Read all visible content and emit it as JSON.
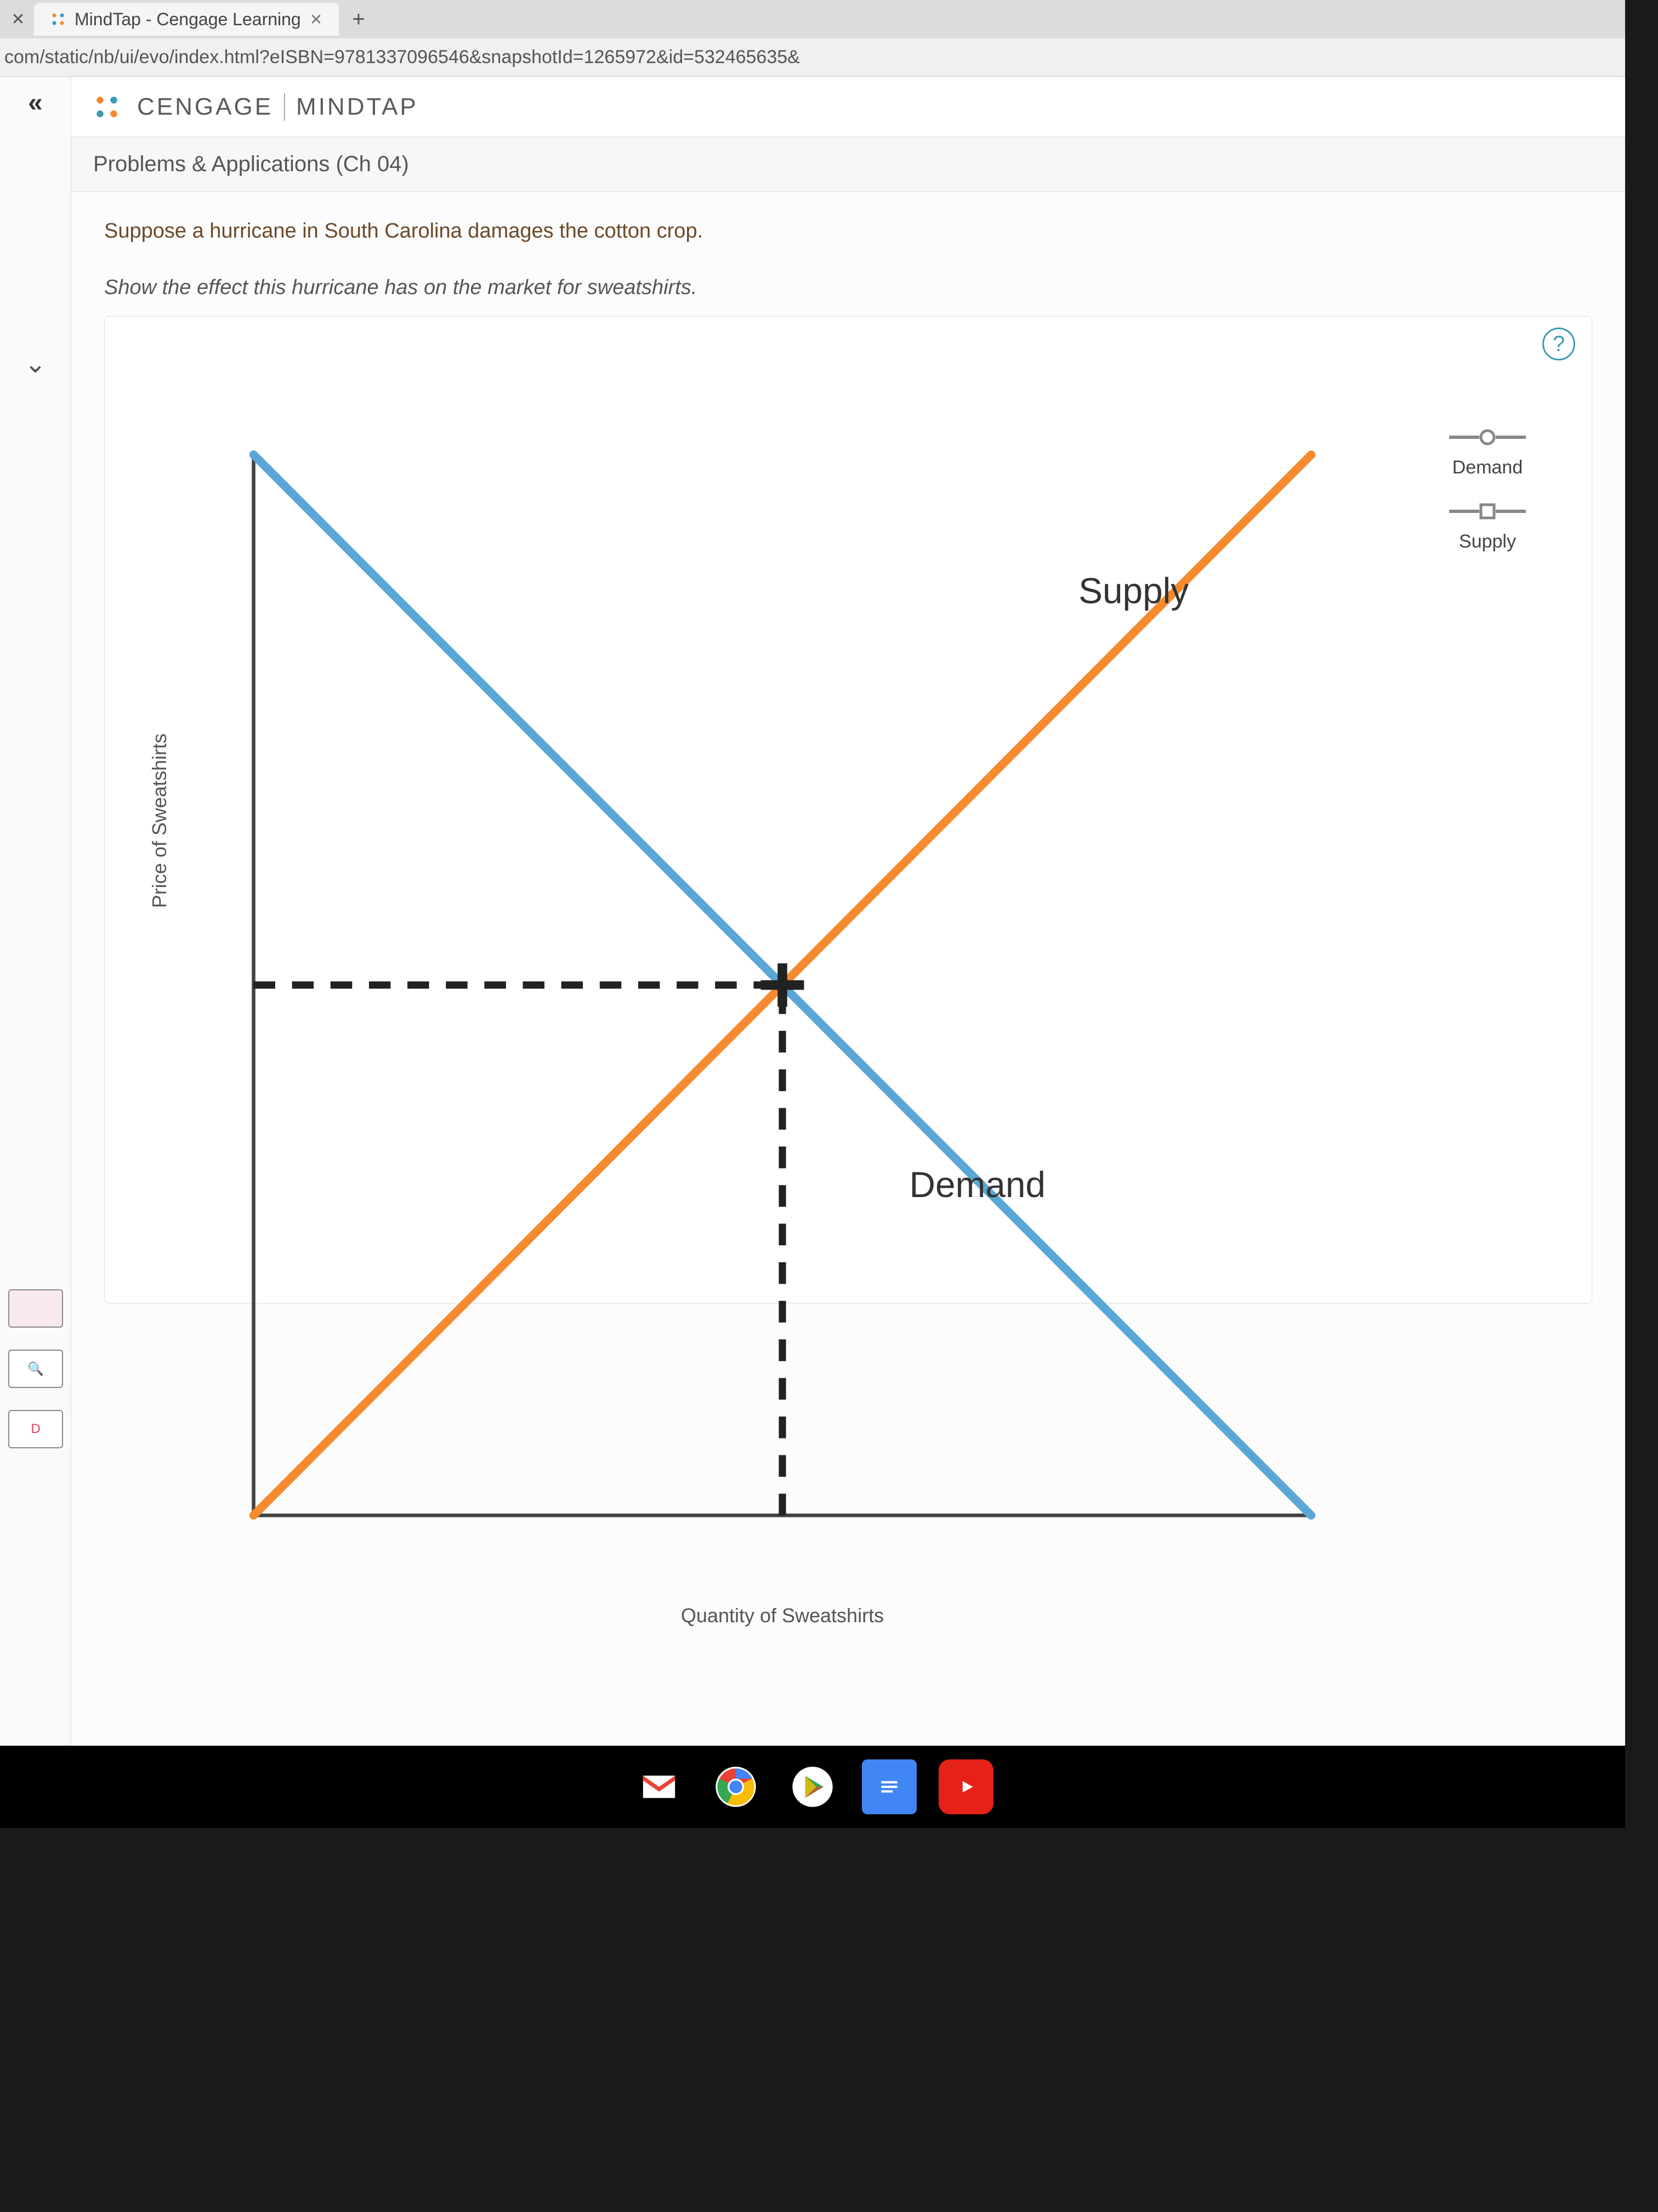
{
  "browser": {
    "tab_title": "MindTap - Cengage Learning",
    "url": "com/static/nb/ui/evo/index.html?eISBN=9781337096546&snapshotId=1265972&id=532465635&"
  },
  "brand": {
    "name": "CENGAGE",
    "product": "MINDTAP"
  },
  "section_title": "Problems & Applications (Ch 04)",
  "question": {
    "prompt": "Suppose a hurricane in South Carolina damages the cotton crop.",
    "instruction": "Show the effect this hurricane has on the market for sweatshirts."
  },
  "chart_data": {
    "type": "line",
    "xlabel": "Quantity of Sweatshirts",
    "ylabel": "Price of Sweatshirts",
    "series": [
      {
        "name": "Demand",
        "x": [
          0,
          100
        ],
        "y": [
          100,
          0
        ],
        "color": "#5aa6d6"
      },
      {
        "name": "Supply",
        "x": [
          0,
          100
        ],
        "y": [
          0,
          100
        ],
        "color": "#f58a2e"
      }
    ],
    "equilibrium": {
      "x": 50,
      "y": 50
    },
    "labels": {
      "supply_line": "Supply",
      "demand_line": "Demand"
    }
  },
  "tools": {
    "demand_label": "Demand",
    "supply_label": "Supply"
  },
  "help_label": "?"
}
